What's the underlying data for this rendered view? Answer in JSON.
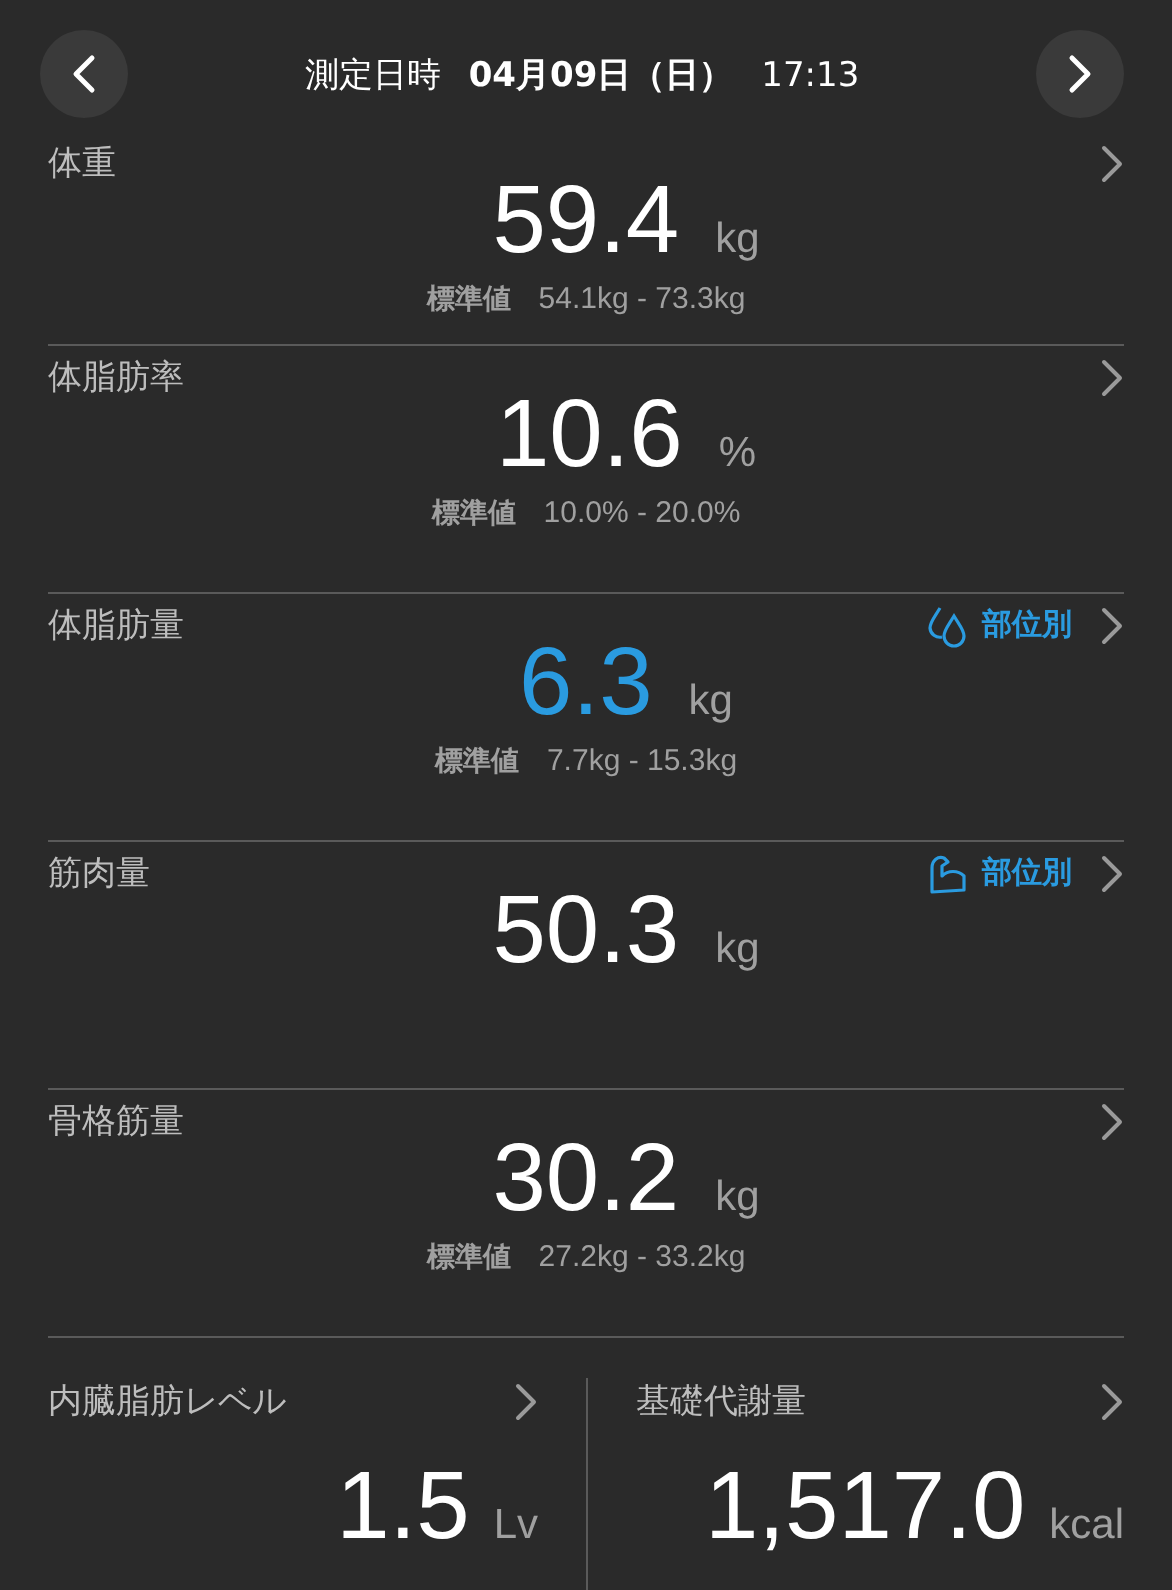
{
  "header": {
    "title": "測定日時",
    "date": "04月09日（日）",
    "time": "17:13"
  },
  "rows": [
    {
      "label": "体重",
      "value": "59.4",
      "unit": "kg",
      "highlighted": false,
      "standard": {
        "label": "標準値",
        "range": "54.1kg - 73.3kg"
      }
    },
    {
      "label": "体脂肪率",
      "value": "10.6",
      "unit": "%",
      "highlighted": false,
      "standard": {
        "label": "標準値",
        "range": "10.0% - 20.0%"
      }
    },
    {
      "label": "体脂肪量",
      "value": "6.3",
      "unit": "kg",
      "highlighted": true,
      "standard": {
        "label": "標準値",
        "range": "7.7kg - 15.3kg"
      },
      "link": {
        "kind": "fat",
        "label": "部位別"
      }
    },
    {
      "label": "筋肉量",
      "value": "50.3",
      "unit": "kg",
      "highlighted": false,
      "link": {
        "kind": "muscle",
        "label": "部位別"
      }
    },
    {
      "label": "骨格筋量",
      "value": "30.2",
      "unit": "kg",
      "highlighted": false,
      "standard": {
        "label": "標準値",
        "range": "27.2kg - 33.2kg"
      }
    }
  ],
  "pair": [
    {
      "label": "内臓脂肪レベル",
      "value": "1.5",
      "unit": "Lv"
    },
    {
      "label": "基礎代謝量",
      "value": "1,517.0",
      "unit": "kcal"
    }
  ]
}
